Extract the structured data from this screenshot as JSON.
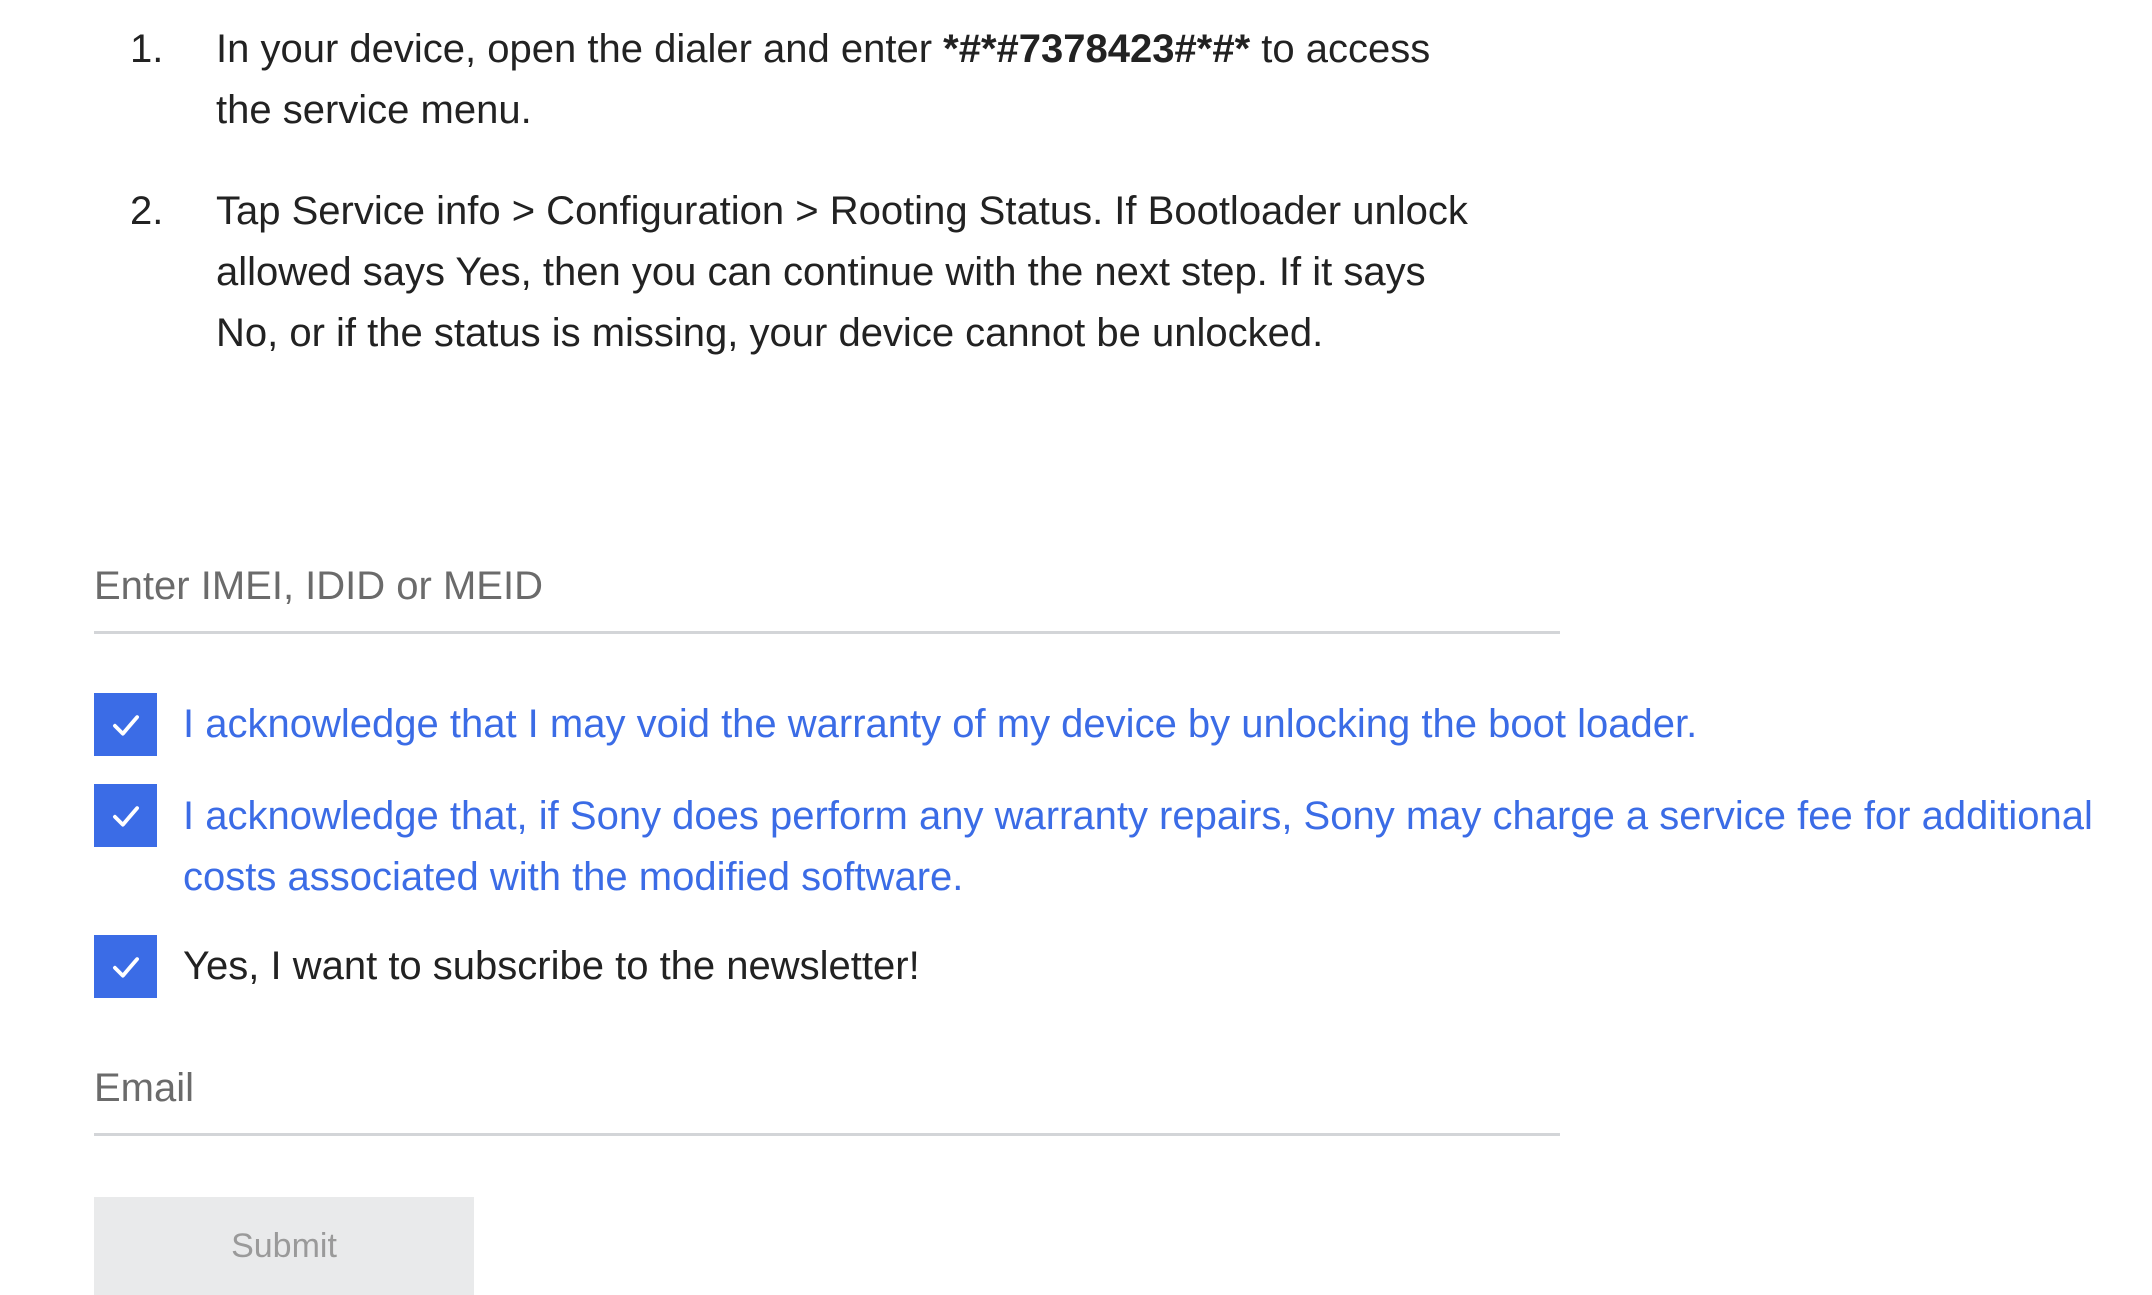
{
  "instructions": {
    "steps": [
      {
        "number": "1.",
        "text_before": "In your device, open the dialer and enter ",
        "code": "*#*#7378423#*#*",
        "text_after": " to access the service menu."
      },
      {
        "number": "2.",
        "text": "Tap Service info > Configuration > Rooting Status. If Bootloader unlock allowed says Yes, then you can continue with the next step. If it says No, or if the status is missing, your device cannot be unlocked."
      }
    ]
  },
  "form": {
    "imei_placeholder": "Enter IMEI, IDID or MEID",
    "imei_value": "",
    "checkboxes": [
      {
        "label": "I acknowledge that I may void the warranty of my device by unlocking the boot loader.",
        "checked": true
      },
      {
        "label": "I acknowledge that, if Sony does perform any warranty repairs, Sony may charge a service fee for additional costs associated with the modified software.",
        "checked": true
      },
      {
        "label": "Yes, I want to subscribe to the newsletter!",
        "checked": true
      }
    ],
    "email_placeholder": "Email",
    "email_value": "",
    "submit_label": "Submit"
  },
  "colors": {
    "accent": "#3b6ce6",
    "text": "#222222",
    "placeholder": "#6b6b6b",
    "underline": "#d3d5d8",
    "submit_bg": "#e9eaeb",
    "submit_text": "#9a9a9a"
  },
  "icons": {
    "checkbox": "checkmark-icon"
  }
}
